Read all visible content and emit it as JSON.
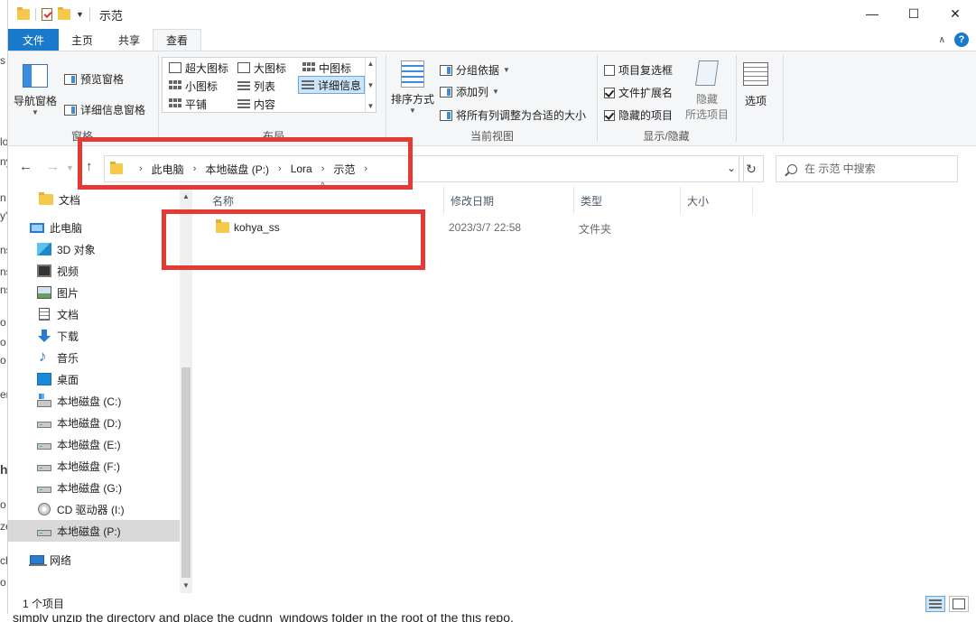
{
  "window": {
    "title": "示范",
    "controls": {
      "minimize": "—",
      "maximize": "☐",
      "close": "✕"
    }
  },
  "ribbon_tabs": [
    "文件",
    "主页",
    "共享",
    "查看"
  ],
  "help": "?",
  "ribbon": {
    "panes": {
      "label": "窗格",
      "nav_pane": "导航窗格",
      "preview": "预览窗格",
      "details": "详细信息窗格"
    },
    "layout": {
      "label": "布局",
      "extra_large": "超大图标",
      "large": "大图标",
      "medium": "中图标",
      "small": "小图标",
      "list": "列表",
      "details": "详细信息",
      "tiles": "平铺",
      "content": "内容"
    },
    "current_view": {
      "label": "当前视图",
      "sort": "排序方式",
      "group_by": "分组依据",
      "add_columns": "添加列",
      "fit_columns": "将所有列调整为合适的大小"
    },
    "show_hide": {
      "label": "显示/隐藏",
      "item_checkboxes": "项目复选框",
      "item_checkboxes_checked": false,
      "file_extensions": "文件扩展名",
      "file_extensions_checked": true,
      "hidden_items": "隐藏的项目",
      "hidden_items_checked": true,
      "hide_selected_1": "隐藏",
      "hide_selected_2": "所选项目"
    },
    "options": "选项"
  },
  "address": {
    "crumbs": [
      "此电脑",
      "本地磁盘 (P:)",
      "Lora",
      "示范"
    ],
    "search_placeholder": "在 示范 中搜索"
  },
  "nav_pane": [
    {
      "label": "文档",
      "icon": "folder-icon"
    },
    {
      "label": "此电脑",
      "icon": "computer-icon"
    },
    {
      "label": "3D 对象",
      "icon": "cube-icon"
    },
    {
      "label": "视频",
      "icon": "video-icon"
    },
    {
      "label": "图片",
      "icon": "picture-icon"
    },
    {
      "label": "文档",
      "icon": "document-icon"
    },
    {
      "label": "下载",
      "icon": "download-icon"
    },
    {
      "label": "音乐",
      "icon": "music-icon"
    },
    {
      "label": "桌面",
      "icon": "desktop-icon"
    },
    {
      "label": "本地磁盘 (C:)",
      "icon": "system-drive-icon"
    },
    {
      "label": "本地磁盘 (D:)",
      "icon": "drive-icon"
    },
    {
      "label": "本地磁盘 (E:)",
      "icon": "drive-icon"
    },
    {
      "label": "本地磁盘 (F:)",
      "icon": "drive-icon"
    },
    {
      "label": "本地磁盘 (G:)",
      "icon": "drive-icon"
    },
    {
      "label": "CD 驱动器 (I:)",
      "icon": "cd-drive-icon"
    },
    {
      "label": "本地磁盘 (P:)",
      "icon": "drive-icon",
      "selected": true
    },
    {
      "label": "网络",
      "icon": "network-icon"
    }
  ],
  "columns": [
    "名称",
    "修改日期",
    "类型",
    "大小"
  ],
  "files": [
    {
      "name": "kohya_ss",
      "modified": "2023/3/7 22:58",
      "type": "文件夹",
      "size": ""
    }
  ],
  "status": {
    "item_count": "1 个项目"
  },
  "background_text": {
    "bottom": "simply unzip the directory and place the  cudnn_windows  folder in the root of the this repo."
  },
  "colors": {
    "accent": "#1979ca",
    "highlight": "#e53935",
    "selection": "#cce4f7"
  }
}
